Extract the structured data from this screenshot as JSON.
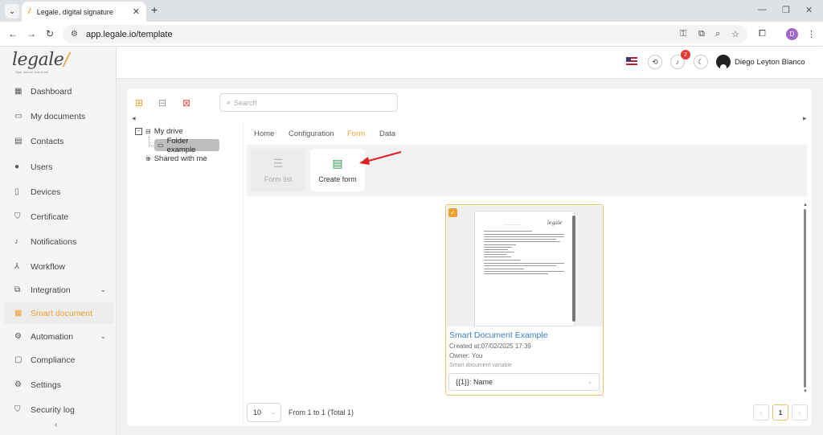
{
  "browser": {
    "tab_title": "Legale, digital signature",
    "url": "app.legale.io/template",
    "profile_initial": "D"
  },
  "brand": {
    "logo_text": "legale",
    "tagline": "Sign, secure and share",
    "accent_color": "#f0a030"
  },
  "sidebar": {
    "items": [
      {
        "label": "Dashboard",
        "icon": "dashboard-icon"
      },
      {
        "label": "My documents",
        "icon": "folder-icon"
      },
      {
        "label": "Contacts",
        "icon": "contacts-icon"
      },
      {
        "label": "Users",
        "icon": "user-icon"
      },
      {
        "label": "Devices",
        "icon": "device-icon"
      },
      {
        "label": "Certificate",
        "icon": "shield-icon"
      },
      {
        "label": "Notifications",
        "icon": "bell-icon"
      },
      {
        "label": "Workflow",
        "icon": "workflow-icon"
      },
      {
        "label": "Integration",
        "icon": "integration-icon"
      },
      {
        "label": "Smart document",
        "icon": "smart-document-icon"
      },
      {
        "label": "Automation",
        "icon": "automation-icon"
      },
      {
        "label": "Compliance",
        "icon": "compliance-icon"
      },
      {
        "label": "Settings",
        "icon": "gear-icon"
      },
      {
        "label": "Security log",
        "icon": "shield-icon"
      }
    ],
    "active_item": "Smart document"
  },
  "header": {
    "notification_count": "2",
    "user_name": "Diego Leyton Blanco"
  },
  "toolbar": {
    "search_placeholder": "Search"
  },
  "tree": {
    "root": "My drive",
    "child": "Folder example",
    "shared": "Shared with me"
  },
  "tabs": [
    "Home",
    "Configuration",
    "Form",
    "Data"
  ],
  "active_tab": "Form",
  "actions": {
    "form_list": "Form list",
    "create_form": "Create form"
  },
  "document": {
    "title": "Smart Document Example",
    "created": "Created at:07/02/2025 17:39",
    "owner": "Owner: You",
    "variable_label": "Smart document variable",
    "variable_value": "{{1}}: Name"
  },
  "pagination": {
    "page_size": "10",
    "range_text": "From 1 to 1 (Total 1)",
    "current_page": "1"
  }
}
